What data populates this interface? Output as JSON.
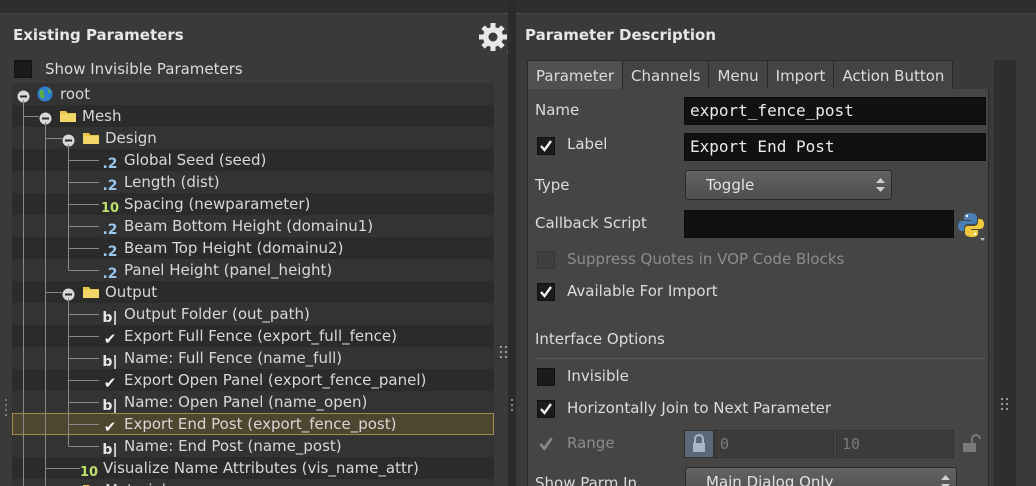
{
  "left": {
    "title": "Existing Parameters",
    "show_invisible_label": "Show Invisible Parameters",
    "tree": [
      {
        "label": "root",
        "icon": "globe-icon"
      },
      {
        "label": "Mesh",
        "icon": "folder-icon"
      },
      {
        "label": "Design",
        "icon": "folder-icon"
      },
      {
        "label": "Global Seed (seed)",
        "icon": "float-param-icon",
        "glyph": ".2"
      },
      {
        "label": "Length (dist)",
        "icon": "float-param-icon",
        "glyph": ".2"
      },
      {
        "label": "Spacing (newparameter)",
        "icon": "int-param-icon",
        "glyph": "10"
      },
      {
        "label": "Beam Bottom Height (domainu1)",
        "icon": "float-param-icon",
        "glyph": ".2"
      },
      {
        "label": "Beam Top Height (domainu2)",
        "icon": "float-param-icon",
        "glyph": ".2"
      },
      {
        "label": "Panel Height (panel_height)",
        "icon": "float-param-icon",
        "glyph": ".2"
      },
      {
        "label": "Output",
        "icon": "folder-icon"
      },
      {
        "label": "Output Folder (out_path)",
        "icon": "string-param-icon",
        "glyph": "b|"
      },
      {
        "label": "Export Full Fence (export_full_fence)",
        "icon": "toggle-param-icon",
        "glyph": "✔"
      },
      {
        "label": "Name: Full Fence (name_full)",
        "icon": "string-param-icon",
        "glyph": "b|"
      },
      {
        "label": "Export Open Panel (export_fence_panel)",
        "icon": "toggle-param-icon",
        "glyph": "✔"
      },
      {
        "label": "Name: Open Panel (name_open)",
        "icon": "string-param-icon",
        "glyph": "b|"
      },
      {
        "label": "Export End Post (export_fence_post)",
        "icon": "toggle-param-icon",
        "glyph": "✔",
        "selected": true
      },
      {
        "label": "Name: End Post (name_post)",
        "icon": "string-param-icon",
        "glyph": "b|"
      },
      {
        "label": "Visualize Name Attributes (vis_name_attr)",
        "icon": "int-param-icon",
        "glyph": "10"
      },
      {
        "label": "Materials",
        "icon": "folder-icon"
      }
    ]
  },
  "right": {
    "title": "Parameter Description",
    "tabs": [
      "Parameter",
      "Channels",
      "Menu",
      "Import",
      "Action Button"
    ],
    "active_tab": "Parameter",
    "name_label": "Name",
    "name_value": "export_fence_post",
    "label_label": "Label",
    "label_value": "Export End Post",
    "type_label": "Type",
    "type_value": "Toggle",
    "callback_label": "Callback Script",
    "callback_value": "",
    "suppress_quotes_label": "Suppress Quotes in VOP Code Blocks",
    "available_import_label": "Available For Import",
    "interface_options_label": "Interface Options",
    "invisible_label": "Invisible",
    "horiz_join_label": "Horizontally Join to Next Parameter",
    "range_label": "Range",
    "range_min": "0",
    "range_max": "10",
    "show_parm_in_label": "Show Parm In",
    "show_parm_in_value": "Main Dialog Only"
  },
  "colors": {
    "panel_bg": "#3a3a3a",
    "field_bg": "#111111",
    "selected_row": "#4f4630",
    "folder": "#e8c64a",
    "float_icon": "#9cc8f0",
    "int_icon": "#b8e06a"
  }
}
